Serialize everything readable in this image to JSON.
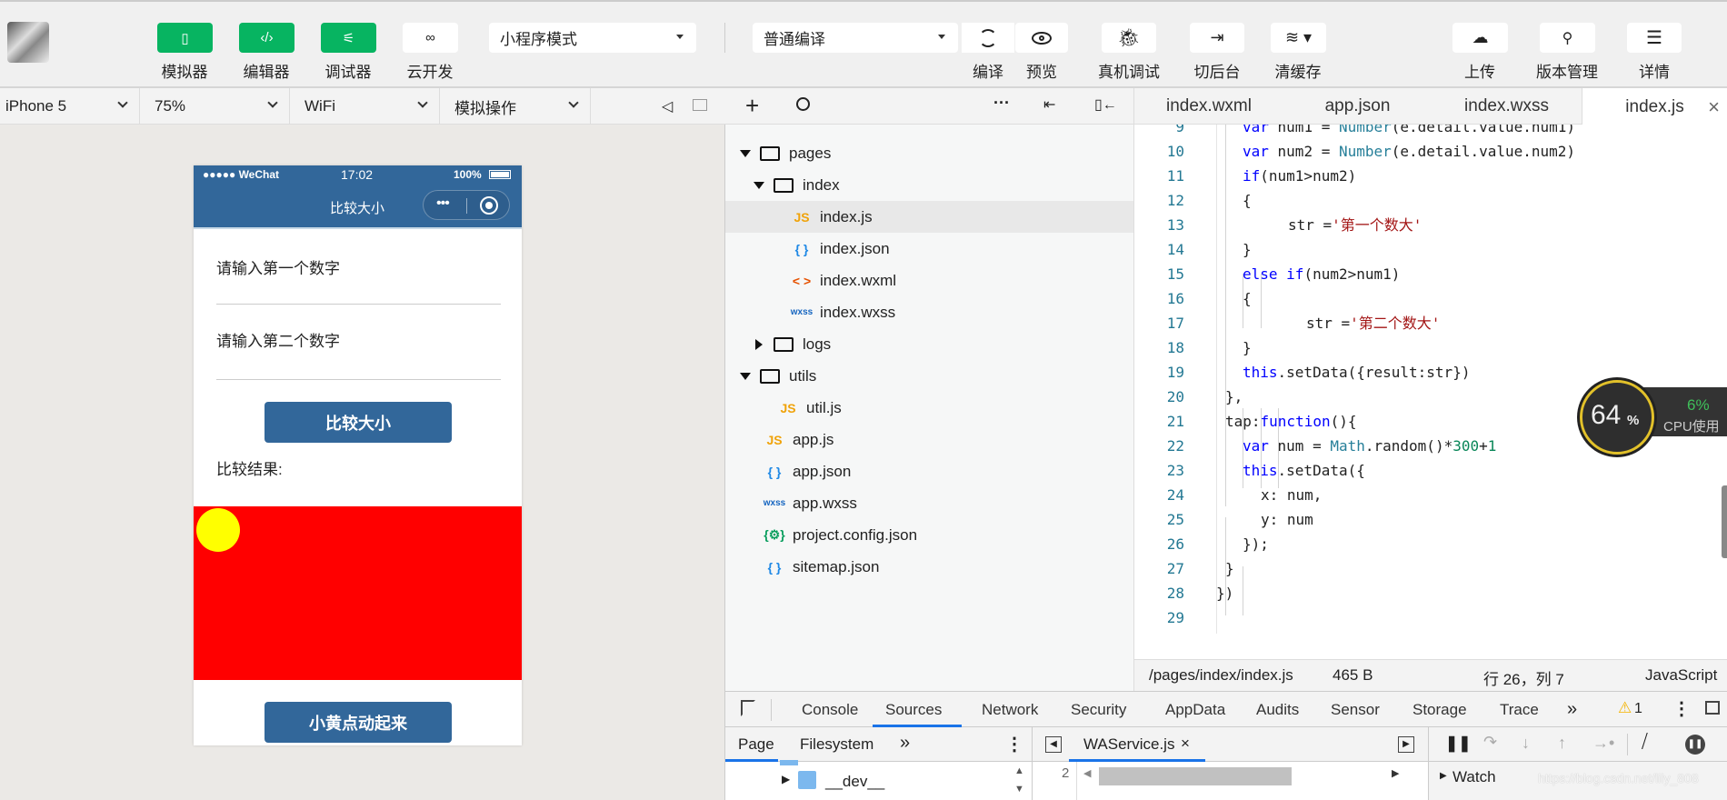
{
  "toolbar": {
    "mode_buttons": [
      {
        "label": "模拟器",
        "icon": "phone-icon"
      },
      {
        "label": "编辑器",
        "icon": "code-icon"
      },
      {
        "label": "调试器",
        "icon": "debug-sliders-icon"
      },
      {
        "label": "云开发",
        "icon": "cloud-link-icon"
      }
    ],
    "mode_select": "小程序模式",
    "compile_select": "普通编译",
    "compile_label": "编译",
    "preview_label": "预览",
    "remote_debug_label": "真机调试",
    "background_label": "切后台",
    "clear_cache_label": "清缓存",
    "upload_label": "上传",
    "version_label": "版本管理",
    "details_label": "详情",
    "accent": "#07b461"
  },
  "simulator": {
    "device": "iPhone 5",
    "zoom": "75%",
    "network": "WiFi",
    "operation": "模拟操作",
    "status": {
      "carrier": "●●●●● WeChat",
      "time": "17:02",
      "battery": "100%"
    },
    "nav_title": "比较大小",
    "label1": "请输入第一个数字",
    "label2": "请输入第二个数字",
    "compare_button": "比较大小",
    "result_label": "比较结果:",
    "animate_button": "小黄点动起来",
    "theme_color": "#32679a",
    "canvas_color": "#ff0000",
    "dot_color": "#ffff00"
  },
  "explorer": {
    "items": [
      {
        "name": "pages",
        "type": "folder",
        "open": true,
        "depth": 0
      },
      {
        "name": "index",
        "type": "folder",
        "open": true,
        "depth": 1
      },
      {
        "name": "index.js",
        "type": "js",
        "depth": 2,
        "selected": true
      },
      {
        "name": "index.json",
        "type": "json",
        "depth": 2
      },
      {
        "name": "index.wxml",
        "type": "wxml",
        "depth": 2
      },
      {
        "name": "index.wxss",
        "type": "wxss",
        "depth": 2
      },
      {
        "name": "logs",
        "type": "folder",
        "open": false,
        "depth": 1
      },
      {
        "name": "utils",
        "type": "folder",
        "open": true,
        "depth": 0
      },
      {
        "name": "util.js",
        "type": "js",
        "depth": 1
      },
      {
        "name": "app.js",
        "type": "js",
        "depth": 0
      },
      {
        "name": "app.json",
        "type": "json",
        "depth": 0
      },
      {
        "name": "app.wxss",
        "type": "wxss",
        "depth": 0
      },
      {
        "name": "project.config.json",
        "type": "config",
        "depth": 0
      },
      {
        "name": "sitemap.json",
        "type": "json",
        "depth": 0
      }
    ]
  },
  "editor": {
    "tabs": [
      "index.wxml",
      "app.json",
      "index.wxss",
      "index.js"
    ],
    "active_tab": "index.js",
    "lines": [
      {
        "n": "9",
        "html": "<span class=\"kw\">var</span> num1 = <span class=\"cls\">Number</span>(e.detail.value.num1)"
      },
      {
        "n": "10",
        "html": "<span class=\"kw\">var</span> num2 = <span class=\"cls\">Number</span>(e.detail.value.num2)"
      },
      {
        "n": "11",
        "html": "<span class=\"kw\">if</span>(num1>num2)"
      },
      {
        "n": "12",
        "html": "{"
      },
      {
        "n": "13",
        "html": "str =<span class=\"str\">'第一个数大'</span>"
      },
      {
        "n": "14",
        "html": "}"
      },
      {
        "n": "15",
        "html": "<span class=\"kw\">else if</span>(num2>num1)"
      },
      {
        "n": "16",
        "html": "{"
      },
      {
        "n": "17",
        "html": "str =<span class=\"str\">'第二个数大'</span>"
      },
      {
        "n": "18",
        "html": "}"
      },
      {
        "n": "19",
        "html": "<span class=\"kw\">this</span>.setData({result:str})"
      },
      {
        "n": "20",
        "html": "},"
      },
      {
        "n": "21",
        "html": "tap:<span class=\"kw\">function</span>(){"
      },
      {
        "n": "22",
        "html": "<span class=\"kw\">var</span> num = <span class=\"cls\">Math</span>.random()*<span class=\"num\">300</span>+<span class=\"num\">1</span>"
      },
      {
        "n": "23",
        "html": "<span class=\"kw\">this</span>.setData({"
      },
      {
        "n": "24",
        "html": "x: num,"
      },
      {
        "n": "25",
        "html": "y: num"
      },
      {
        "n": "26",
        "html": "});"
      },
      {
        "n": "27",
        "html": "}"
      },
      {
        "n": "28",
        "html": "})"
      },
      {
        "n": "29",
        "html": ""
      }
    ],
    "status": {
      "path": "/pages/index/index.js",
      "size": "465 B",
      "position": "行 26，列 7",
      "language": "JavaScript"
    }
  },
  "cpu_widget": {
    "memory_percent": "64",
    "percent_sign": "%",
    "cpu_value": "6%",
    "cpu_label": "CPU使用"
  },
  "devtools": {
    "tabs": [
      "Console",
      "Sources",
      "Network",
      "Security",
      "AppData",
      "Audits",
      "Sensor",
      "Storage",
      "Trace"
    ],
    "active_tab": "Sources",
    "more": "»",
    "warnings": "1",
    "nav_tabs": [
      "Page",
      "Filesystem"
    ],
    "file_tab": "WAService.js",
    "tree_item": "__dev__",
    "line_number": "2",
    "watch_label": "Watch"
  },
  "watermark": "https://blog.csdn.net/lily_808"
}
